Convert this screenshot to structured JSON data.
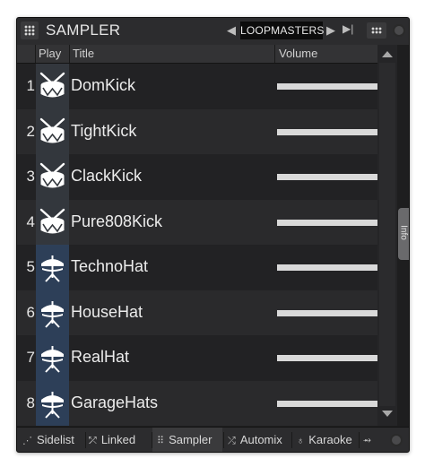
{
  "header": {
    "title": "SAMPLER",
    "bank": "LOOPMASTERS",
    "prev_glyph": "◀",
    "next_glyph": "▶",
    "skip_glyph": "▶|"
  },
  "columns": {
    "play": "Play",
    "title": "Title",
    "volume": "Volume"
  },
  "rows": [
    {
      "num": "1",
      "name": "DomKick",
      "icon": "drum-icon",
      "volume": 1.0
    },
    {
      "num": "2",
      "name": "TightKick",
      "icon": "drum-icon",
      "volume": 1.0
    },
    {
      "num": "3",
      "name": "ClackKick",
      "icon": "drum-icon",
      "volume": 1.0
    },
    {
      "num": "4",
      "name": "Pure808Kick",
      "icon": "drum-icon",
      "volume": 1.0
    },
    {
      "num": "5",
      "name": "TechnoHat",
      "icon": "hihat-icon",
      "volume": 1.0
    },
    {
      "num": "6",
      "name": "HouseHat",
      "icon": "hihat-icon",
      "volume": 1.0
    },
    {
      "num": "7",
      "name": "RealHat",
      "icon": "hihat-icon",
      "volume": 1.0
    },
    {
      "num": "8",
      "name": "GarageHats",
      "icon": "hihat-icon",
      "volume": 1.0
    }
  ],
  "side_tab": "Info",
  "bottom_tabs": [
    {
      "label": "Sidelist",
      "icon": "sidelist-icon",
      "active": false
    },
    {
      "label": "Linked",
      "icon": "linked-icon",
      "active": false
    },
    {
      "label": "Sampler",
      "icon": "grid-icon",
      "active": true
    },
    {
      "label": "Automix",
      "icon": "shuffle-icon",
      "active": false
    },
    {
      "label": "Karaoke",
      "icon": "microphone-icon",
      "active": false
    }
  ],
  "colors": {
    "kick_pad": "#33373d",
    "hat_pad": "#2d3f58",
    "row_even": "#222224",
    "row_odd": "#2a2a2c",
    "volume_bar": "#d9d9d9"
  }
}
